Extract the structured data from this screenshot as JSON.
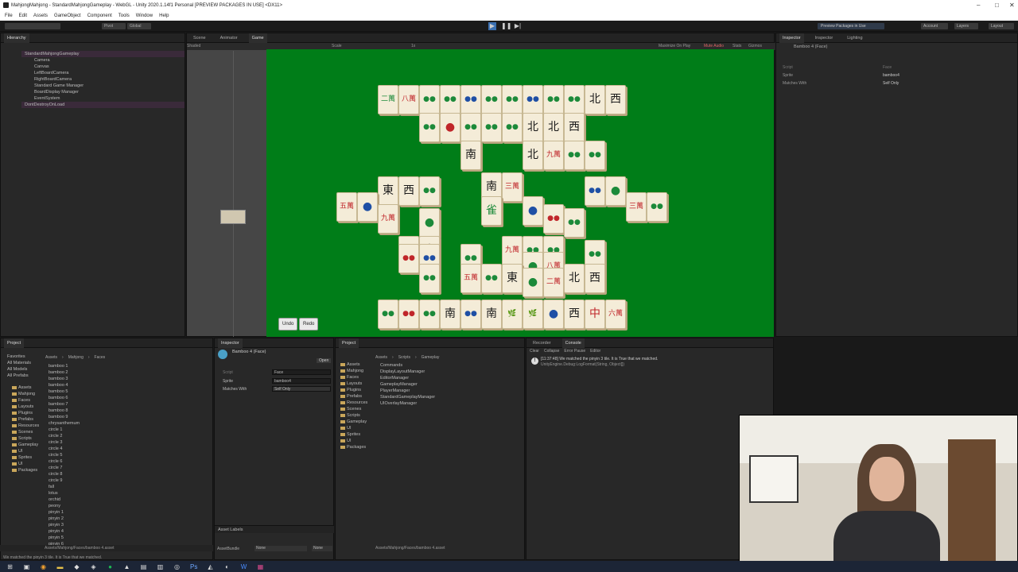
{
  "window": {
    "title": "MahjongMahjong - StandardMahjongGameplay - WebGL - Unity 2020.1.14f1 Personal [PREVIEW PACKAGES IN USE] <DX11>"
  },
  "menu": [
    "File",
    "Edit",
    "Assets",
    "GameObject",
    "Component",
    "Tools",
    "Window",
    "Help"
  ],
  "toolbar": {
    "preview_packages": "Preview Packages in Use",
    "account": "Account",
    "layers": "Layers",
    "layout": "Layout",
    "pivot": "Pivot",
    "global": "Global"
  },
  "hierarchy": {
    "tab": "Hierarchy",
    "items": [
      "StandardMahjongGameplay",
      "Camera",
      "Canvas",
      "LeftBoardCamera",
      "RightBoardCamera",
      "Standard Game Manager",
      "BoardDisplay Manager",
      "EventSystem",
      "DontDestroyOnLoad"
    ]
  },
  "scene_tabs": [
    "Scene",
    "Animator",
    "Game"
  ],
  "scene_shading": "Shaded",
  "game_bar": {
    "display": "Display 1",
    "aspect": "16:9",
    "scale_label": "Scale",
    "scale_value": "1x",
    "maximize": "Maximize On Play",
    "mute": "Mute Audio",
    "stats": "Stats",
    "gizmos": "Gizmos"
  },
  "game_buttons": {
    "undo": "Undo",
    "redo": "Redo"
  },
  "tiles": [
    [
      "二萬",
      "green"
    ],
    [
      "八萬",
      "red"
    ],
    [
      "●●",
      "green"
    ],
    [
      "●●",
      "green"
    ],
    [
      "●●",
      "blue"
    ],
    [
      "●●",
      "green"
    ],
    [
      "●●",
      "green"
    ],
    [
      "●●",
      "blue"
    ],
    [
      "●●",
      "green"
    ],
    [
      "●●",
      "green"
    ],
    [
      "北",
      "black"
    ],
    [
      "西",
      "black"
    ],
    [
      "●●",
      "green"
    ],
    [
      "●",
      "red"
    ],
    [
      "●●",
      "green"
    ],
    [
      "●●",
      "green"
    ],
    [
      "●●",
      "green"
    ],
    [
      "北",
      "black"
    ],
    [
      "北",
      "black"
    ],
    [
      "西",
      "black"
    ],
    [
      "南",
      "black"
    ],
    [
      "北",
      "black"
    ],
    [
      "九萬",
      "red"
    ],
    [
      "●●",
      "green"
    ],
    [
      "●●",
      "green"
    ],
    [
      "東",
      "black"
    ],
    [
      "西",
      "black"
    ],
    [
      "●●",
      "green"
    ],
    [
      "南",
      "black"
    ],
    [
      "三萬",
      "red"
    ],
    [
      "●●",
      "blue"
    ],
    [
      "●",
      "green"
    ],
    [
      "五萬",
      "red"
    ],
    [
      "●",
      "blue"
    ],
    [
      "九萬",
      "red"
    ],
    [
      "●",
      "green"
    ],
    [
      "雀",
      "green"
    ],
    [
      "●",
      "blue"
    ],
    [
      "●●",
      "red"
    ],
    [
      "●●",
      "green"
    ],
    [
      "三萬",
      "red"
    ],
    [
      "●●",
      "green"
    ],
    [
      "●●",
      "green"
    ],
    [
      "東",
      "black"
    ],
    [
      "九萬",
      "red"
    ],
    [
      "●●",
      "green"
    ],
    [
      "●●",
      "green"
    ],
    [
      "●●",
      "red"
    ],
    [
      "●●",
      "blue"
    ],
    [
      "●●",
      "green"
    ],
    [
      "●",
      "green"
    ],
    [
      "八萬",
      "red"
    ],
    [
      "●●",
      "green"
    ],
    [
      "●●",
      "green"
    ],
    [
      "五萬",
      "red"
    ],
    [
      "●●",
      "green"
    ],
    [
      "東",
      "black"
    ],
    [
      "●",
      "green"
    ],
    [
      "二萬",
      "red"
    ],
    [
      "北",
      "black"
    ],
    [
      "西",
      "black"
    ],
    [
      "●●",
      "green"
    ],
    [
      "●●",
      "red"
    ],
    [
      "●●",
      "green"
    ],
    [
      "南",
      "black"
    ],
    [
      "●●",
      "blue"
    ],
    [
      "南",
      "black"
    ],
    [
      "🌿",
      "green"
    ],
    [
      "🌿",
      "green"
    ],
    [
      "●",
      "blue"
    ],
    [
      "西",
      "black"
    ],
    [
      "中",
      "red"
    ],
    [
      "六萬",
      "red"
    ]
  ],
  "inspector_top": {
    "tabs": [
      "Inspector",
      "Inspector",
      "Lighting"
    ],
    "object": "Bamboo 4 (Face)",
    "script_label": "Script",
    "script_value": "Face",
    "sprite_label": "Sprite",
    "sprite_value": "bamboo4",
    "matches_label": "Matches With",
    "matches_value": "Self Only"
  },
  "project_left": {
    "tab": "Project",
    "breadcrumb": [
      "Assets",
      "Mahjong",
      "Faces"
    ],
    "favorites": [
      "Favorites",
      "All Materials",
      "All Models",
      "All Prefabs"
    ],
    "folders": [
      "Assets",
      "Mahjong",
      "Faces",
      "Layouts",
      "Plugins",
      "Prefabs",
      "Resources",
      "Scenes",
      "Scripts",
      "Gameplay",
      "UI",
      "Sprites",
      "UI",
      "Packages"
    ],
    "files": [
      "bamboo 1",
      "bamboo 2",
      "bamboo 3",
      "bamboo 4",
      "bamboo 5",
      "bamboo 6",
      "bamboo 7",
      "bamboo 8",
      "bamboo 9",
      "chrysanthemum",
      "circle 1",
      "circle 2",
      "circle 3",
      "circle 4",
      "circle 5",
      "circle 6",
      "circle 7",
      "circle 8",
      "circle 9",
      "fall",
      "lotus",
      "orchid",
      "peony",
      "pinyin 1",
      "pinyin 2",
      "pinyin 3",
      "pinyin 4",
      "pinyin 5",
      "pinyin 6"
    ],
    "path": "Assets/Mahjong/Faces/bamboo 4.asset"
  },
  "inspector_mid": {
    "tab": "Inspector",
    "object": "Bamboo 4 (Face)",
    "open": "Open",
    "script_label": "Script",
    "script_value": "Face",
    "sprite_label": "Sprite",
    "sprite_value": "bamboo4",
    "matches_label": "Matches With",
    "matches_value": "Self Only",
    "asset_labels": "Asset Labels",
    "asset_bundle": "AssetBundle",
    "bundle_value": "None",
    "variant_value": "None"
  },
  "project_right": {
    "tab": "Project",
    "breadcrumb": [
      "Assets",
      "Scripts",
      "Gameplay"
    ],
    "files": [
      "Commands",
      "DisplayLayoutManager",
      "EditorManager",
      "GameplayManager",
      "PlayerManager",
      "StandardGameplayManager",
      "UIOverlayManager"
    ],
    "path": "Assets/Mahjong/Faces/bamboo 4.asset"
  },
  "console": {
    "tabs": [
      "Recorder",
      "Console"
    ],
    "clear": "Clear",
    "collapse": "Collapse",
    "error_pause": "Error Pause",
    "editor": "Editor",
    "message": "[11:37:48] We matched the pinyin 3 tile. It is True that we matched.",
    "detail": "UnityEngine.Debug:LogFormat(String, Object[])"
  },
  "status": "We matched the pinyin 3 tile. It is True that we matched."
}
